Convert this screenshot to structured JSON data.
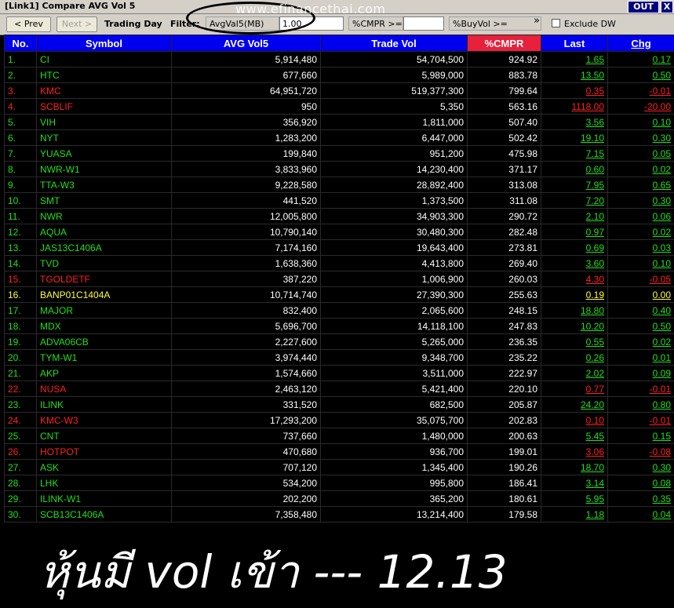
{
  "window": {
    "title": "[Link1] Compare AVG Vol 5",
    "out_label": "OUT",
    "close_label": "X"
  },
  "toolbar": {
    "prev_label": "< Prev",
    "next_label": "Next >",
    "trading_day_label": "Trading Day",
    "filter_label": "Filter:",
    "avgval_label": "AvgVal5(MB) >=",
    "avgval_value": "1.00",
    "cmpr_label": "%CMPR >=",
    "cmpr_value": "",
    "buyvol_label": "%BuyVol >=",
    "more_glyph": "»",
    "exclude_dw_label": "Exclude DW"
  },
  "watermark": "www.efinancethai.com",
  "columns": [
    "No.",
    "Symbol",
    "AVG Vol5",
    "Trade Vol",
    "%CMPR",
    "Last",
    "Chg"
  ],
  "colors": {
    "up": "#22e01a",
    "down": "#ff2020",
    "flat": "#ffff30",
    "header": "#0000ee",
    "sorted_header": "#e8203c"
  },
  "rows": [
    {
      "no": "1.",
      "symbol": "CI",
      "avg": "5,914,480",
      "vol": "54,704,500",
      "cmpr": "924.92",
      "last": "1.65",
      "chg": "0.17",
      "dir": "up"
    },
    {
      "no": "2.",
      "symbol": "HTC",
      "avg": "677,660",
      "vol": "5,989,000",
      "cmpr": "883.78",
      "last": "13.50",
      "chg": "0.50",
      "dir": "up"
    },
    {
      "no": "3.",
      "symbol": "KMC",
      "avg": "64,951,720",
      "vol": "519,377,300",
      "cmpr": "799.64",
      "last": "0.35",
      "chg": "-0.01",
      "dir": "down"
    },
    {
      "no": "4.",
      "symbol": "SCBLIF",
      "avg": "950",
      "vol": "5,350",
      "cmpr": "563.16",
      "last": "1118.00",
      "chg": "-20.00",
      "dir": "down"
    },
    {
      "no": "5.",
      "symbol": "VIH",
      "avg": "356,920",
      "vol": "1,811,000",
      "cmpr": "507.40",
      "last": "3.56",
      "chg": "0.10",
      "dir": "up"
    },
    {
      "no": "6.",
      "symbol": "NYT",
      "avg": "1,283,200",
      "vol": "6,447,000",
      "cmpr": "502.42",
      "last": "19.10",
      "chg": "0.30",
      "dir": "up"
    },
    {
      "no": "7.",
      "symbol": "YUASA",
      "avg": "199,840",
      "vol": "951,200",
      "cmpr": "475.98",
      "last": "7.15",
      "chg": "0.05",
      "dir": "up"
    },
    {
      "no": "8.",
      "symbol": "NWR-W1",
      "avg": "3,833,960",
      "vol": "14,230,400",
      "cmpr": "371.17",
      "last": "0.60",
      "chg": "0.02",
      "dir": "up"
    },
    {
      "no": "9.",
      "symbol": "TTA-W3",
      "avg": "9,228,580",
      "vol": "28,892,400",
      "cmpr": "313.08",
      "last": "7.95",
      "chg": "0.65",
      "dir": "up"
    },
    {
      "no": "10.",
      "symbol": "SMT",
      "avg": "441,520",
      "vol": "1,373,500",
      "cmpr": "311.08",
      "last": "7.20",
      "chg": "0.30",
      "dir": "up"
    },
    {
      "no": "11.",
      "symbol": "NWR",
      "avg": "12,005,800",
      "vol": "34,903,300",
      "cmpr": "290.72",
      "last": "2.10",
      "chg": "0.06",
      "dir": "up"
    },
    {
      "no": "12.",
      "symbol": "AQUA",
      "avg": "10,790,140",
      "vol": "30,480,300",
      "cmpr": "282.48",
      "last": "0.97",
      "chg": "0.02",
      "dir": "up"
    },
    {
      "no": "13.",
      "symbol": "JAS13C1406A",
      "avg": "7,174,160",
      "vol": "19,643,400",
      "cmpr": "273.81",
      "last": "0.69",
      "chg": "0.03",
      "dir": "up"
    },
    {
      "no": "14.",
      "symbol": "TVD",
      "avg": "1,638,360",
      "vol": "4,413,800",
      "cmpr": "269.40",
      "last": "3.60",
      "chg": "0.10",
      "dir": "up"
    },
    {
      "no": "15.",
      "symbol": "TGOLDETF",
      "avg": "387,220",
      "vol": "1,006,900",
      "cmpr": "260.03",
      "last": "4.30",
      "chg": "-0.05",
      "dir": "down"
    },
    {
      "no": "16.",
      "symbol": "BANP01C1404A",
      "avg": "10,714,740",
      "vol": "27,390,300",
      "cmpr": "255.63",
      "last": "0.19",
      "chg": "0.00",
      "dir": "flat"
    },
    {
      "no": "17.",
      "symbol": "MAJOR",
      "avg": "832,400",
      "vol": "2,065,600",
      "cmpr": "248.15",
      "last": "18.80",
      "chg": "0.40",
      "dir": "up"
    },
    {
      "no": "18.",
      "symbol": "MDX",
      "avg": "5,696,700",
      "vol": "14,118,100",
      "cmpr": "247.83",
      "last": "10.20",
      "chg": "0.50",
      "dir": "up"
    },
    {
      "no": "19.",
      "symbol": "ADVA06CB",
      "avg": "2,227,600",
      "vol": "5,265,000",
      "cmpr": "236.35",
      "last": "0.55",
      "chg": "0.02",
      "dir": "up"
    },
    {
      "no": "20.",
      "symbol": "TYM-W1",
      "avg": "3,974,440",
      "vol": "9,348,700",
      "cmpr": "235.22",
      "last": "0.26",
      "chg": "0.01",
      "dir": "up"
    },
    {
      "no": "21.",
      "symbol": "AKP",
      "avg": "1,574,660",
      "vol": "3,511,000",
      "cmpr": "222.97",
      "last": "2.02",
      "chg": "0.09",
      "dir": "up"
    },
    {
      "no": "22.",
      "symbol": "NUSA",
      "avg": "2,463,120",
      "vol": "5,421,400",
      "cmpr": "220.10",
      "last": "0.77",
      "chg": "-0.01",
      "dir": "down"
    },
    {
      "no": "23.",
      "symbol": "ILINK",
      "avg": "331,520",
      "vol": "682,500",
      "cmpr": "205.87",
      "last": "24.20",
      "chg": "0.80",
      "dir": "up"
    },
    {
      "no": "24.",
      "symbol": "KMC-W3",
      "avg": "17,293,200",
      "vol": "35,075,700",
      "cmpr": "202.83",
      "last": "0.10",
      "chg": "-0.01",
      "dir": "down"
    },
    {
      "no": "25.",
      "symbol": "CNT",
      "avg": "737,660",
      "vol": "1,480,000",
      "cmpr": "200.63",
      "last": "5.45",
      "chg": "0.15",
      "dir": "up"
    },
    {
      "no": "26.",
      "symbol": "HOTPOT",
      "avg": "470,680",
      "vol": "936,700",
      "cmpr": "199.01",
      "last": "3.06",
      "chg": "-0.08",
      "dir": "down"
    },
    {
      "no": "27.",
      "symbol": "ASK",
      "avg": "707,120",
      "vol": "1,345,400",
      "cmpr": "190.26",
      "last": "18.70",
      "chg": "0.30",
      "dir": "up"
    },
    {
      "no": "28.",
      "symbol": "LHK",
      "avg": "534,200",
      "vol": "995,800",
      "cmpr": "186.41",
      "last": "3.14",
      "chg": "0.08",
      "dir": "up"
    },
    {
      "no": "29.",
      "symbol": "ILINK-W1",
      "avg": "202,200",
      "vol": "365,200",
      "cmpr": "180.61",
      "last": "5.95",
      "chg": "0.35",
      "dir": "up"
    },
    {
      "no": "30.",
      "symbol": "SCB13C1406A",
      "avg": "7,358,480",
      "vol": "13,214,400",
      "cmpr": "179.58",
      "last": "1.18",
      "chg": "0.04",
      "dir": "up"
    }
  ],
  "caption": "หุ้นมี vol เข้า --- 12.13"
}
